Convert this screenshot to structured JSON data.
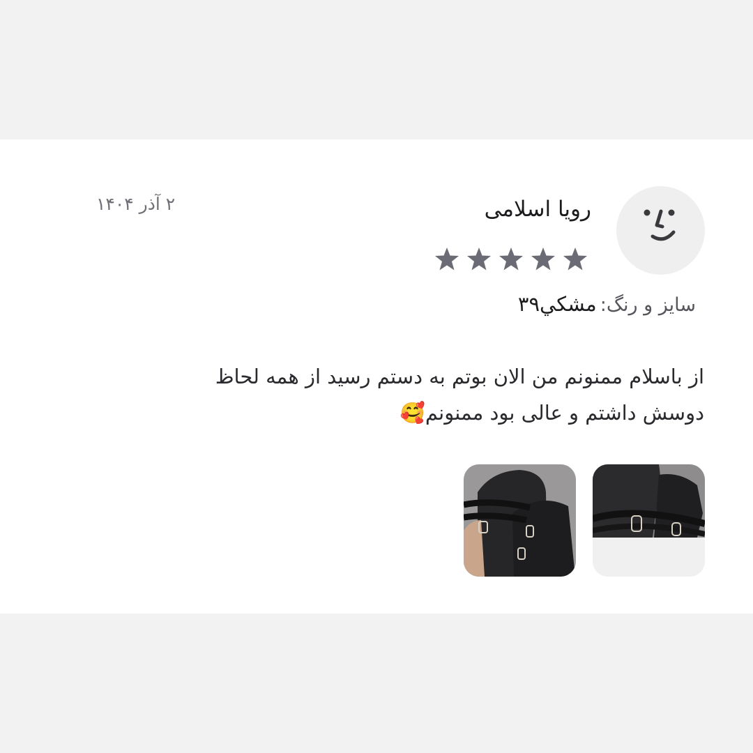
{
  "review": {
    "author_name": "رویا اسلامی",
    "date": "۲ آذر ۱۴۰۴",
    "rating": 5,
    "rating_max": 5,
    "variant_label": "سایز و رنگ:",
    "variant_value": "مشکي۳۹",
    "comment_lines": [
      "از باسلام ممنونم من الان بوتم به دستم رسید از همه لحاظ",
      "دوسش داشتم و عالی بود ممنونم🥰"
    ],
    "avatar_icon": "smiley-face-icon",
    "photos": [
      {
        "name": "review-photo-1",
        "subject": "black-boots-top-view"
      },
      {
        "name": "review-photo-2",
        "subject": "black-boots-side-view"
      }
    ]
  },
  "colors": {
    "page_bg": "#f2f2f2",
    "card_bg": "#ffffff",
    "star": "#6b6b75",
    "avatar_bg": "#efefef"
  }
}
